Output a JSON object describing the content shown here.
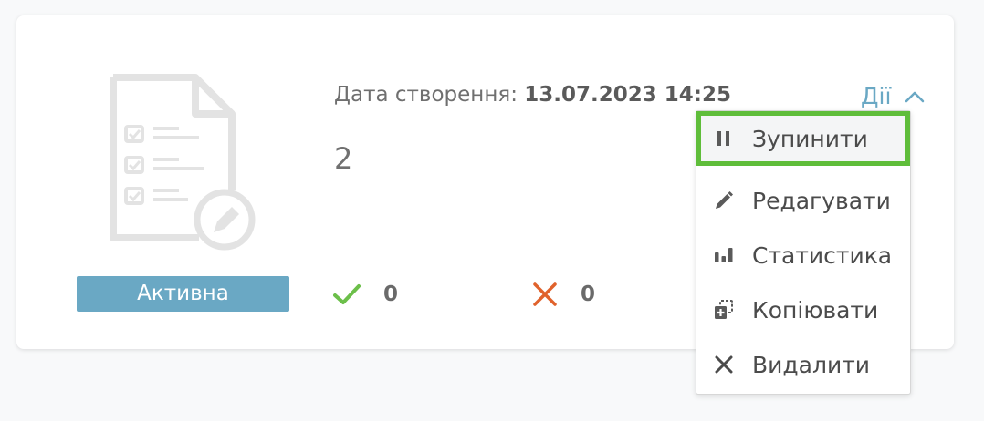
{
  "card": {
    "status_badge": "Активна",
    "created_label": "Дата створення:",
    "created_value": "13.07.2023 14:25",
    "count": "2",
    "stats": {
      "correct_count": "0",
      "wrong_count": "0"
    },
    "actions_label": "Дії"
  },
  "menu": {
    "items": [
      {
        "label": "Зупинити",
        "icon": "pause-icon",
        "highlighted": true
      },
      {
        "label": "Редагувати",
        "icon": "pencil-icon"
      },
      {
        "label": "Статистика",
        "icon": "bar-chart-icon"
      },
      {
        "label": "Копіювати",
        "icon": "copy-icon"
      },
      {
        "label": "Видалити",
        "icon": "close-icon"
      }
    ]
  },
  "colors": {
    "accent": "#6aa8c4",
    "success": "#6cbf4a",
    "danger": "#e0622c",
    "highlight_border": "#5fbd3a"
  }
}
